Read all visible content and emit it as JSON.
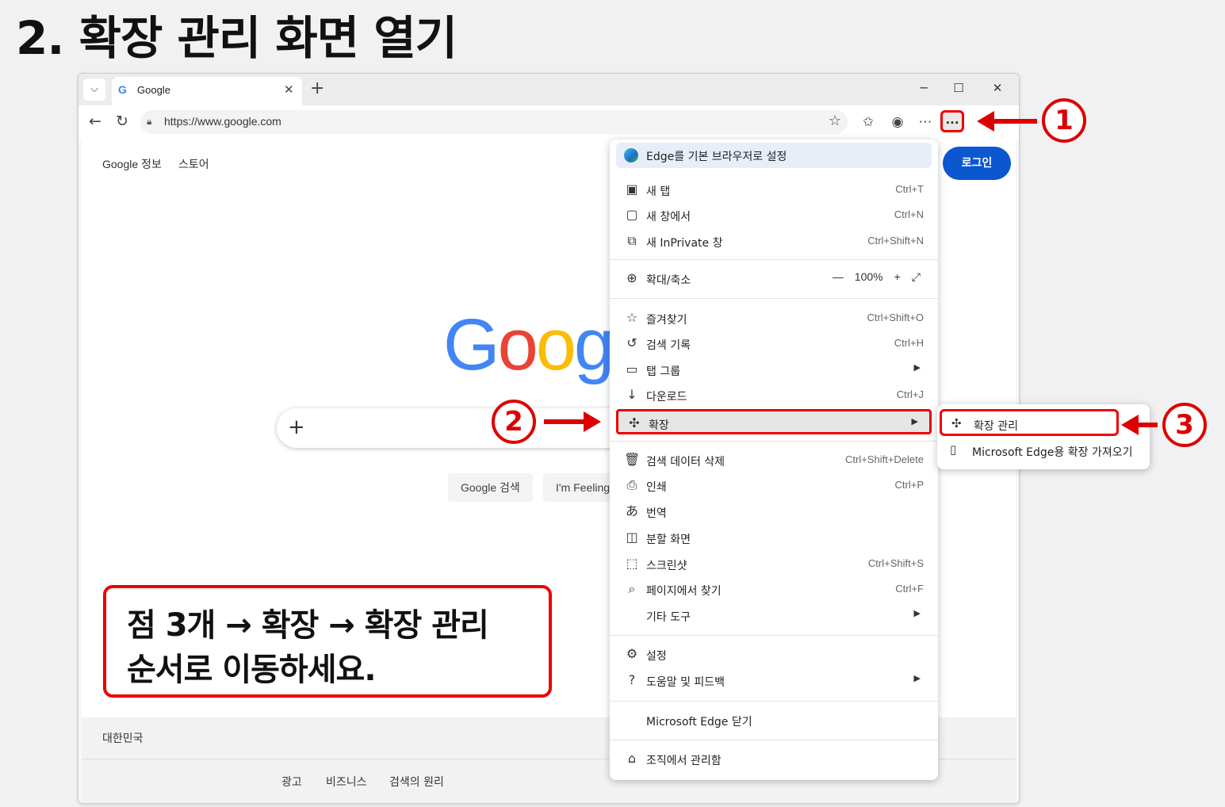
{
  "slide": {
    "title": "2. 확장 관리 화면 열기"
  },
  "browser": {
    "tab_title": "Google",
    "favicon": "G",
    "url": "https://www.google.com",
    "window_controls": [
      "─",
      "☐",
      "✕"
    ]
  },
  "google": {
    "top_links": [
      "Google 정보",
      "스토어"
    ],
    "login": "로그인",
    "logo_letters": [
      {
        "ch": "G",
        "color": "#4285F4"
      },
      {
        "ch": "o",
        "color": "#EA4335"
      },
      {
        "ch": "o",
        "color": "#FBBC05"
      },
      {
        "ch": "g",
        "color": "#4285F4"
      }
    ],
    "search_button": "Google 검색",
    "lucky_button": "I'm Feeling",
    "country": "대한민국",
    "footer_links": [
      "광고",
      "비즈니스",
      "검색의 원리"
    ]
  },
  "menu": {
    "banner": "Edge를 기본 브라우저로 설정",
    "items": [
      {
        "icon": "new-tab-icon",
        "glyph": "▣",
        "label": "새 탭",
        "shortcut": "Ctrl+T"
      },
      {
        "icon": "new-window-icon",
        "glyph": "▢",
        "label": "새 창에서",
        "shortcut": "Ctrl+N"
      },
      {
        "icon": "inprivate-icon",
        "glyph": "⧉",
        "label": "새 InPrivate 창",
        "shortcut": "Ctrl+Shift+N"
      },
      {
        "icon": "zoom-icon",
        "glyph": "⊕",
        "label": "확대/축소",
        "zoom": {
          "minus": "—",
          "value": "100%",
          "plus": "+",
          "full": "⤢"
        }
      },
      {
        "icon": "favorites-icon",
        "glyph": "☆",
        "label": "즐겨찾기",
        "shortcut": "Ctrl+Shift+O"
      },
      {
        "icon": "history-icon",
        "glyph": "↺",
        "label": "검색 기록",
        "shortcut": "Ctrl+H"
      },
      {
        "icon": "tab-groups-icon",
        "glyph": "▭",
        "label": "탭 그룹",
        "arrow": "▶"
      },
      {
        "icon": "download-icon",
        "glyph": "↓",
        "label": "다운로드",
        "shortcut": "Ctrl+J"
      },
      {
        "icon": "extensions-icon",
        "glyph": "✣",
        "label": "확장",
        "arrow": "▶"
      },
      {
        "icon": "delete-icon",
        "glyph": "🗑",
        "label": "검색 데이터 삭제",
        "shortcut": "Ctrl+Shift+Delete"
      },
      {
        "icon": "print-icon",
        "glyph": "⎙",
        "label": "인쇄",
        "shortcut": "Ctrl+P"
      },
      {
        "icon": "translate-icon",
        "glyph": "あ",
        "label": "번역"
      },
      {
        "icon": "split-screen-icon",
        "glyph": "◫",
        "label": "분할 화면"
      },
      {
        "icon": "screenshot-icon",
        "glyph": "⬚",
        "label": "스크린샷",
        "shortcut": "Ctrl+Shift+S"
      },
      {
        "icon": "find-icon",
        "glyph": "⌕",
        "label": "페이지에서 찾기",
        "shortcut": "Ctrl+F"
      },
      {
        "icon": "",
        "glyph": "",
        "label": "기타 도구",
        "arrow": "▶"
      },
      {
        "icon": "settings-icon",
        "glyph": "⚙",
        "label": "설정"
      },
      {
        "icon": "help-icon",
        "glyph": "?",
        "label": "도움말 및 피드백",
        "arrow": "▶"
      },
      {
        "icon": "",
        "glyph": "",
        "label": "Microsoft Edge 닫기"
      },
      {
        "icon": "organization-icon",
        "glyph": "⌂",
        "label": "조직에서 관리함"
      }
    ]
  },
  "submenu": {
    "items": [
      {
        "icon": "extensions-icon",
        "glyph": "✣",
        "label": "확장 관리"
      },
      {
        "icon": "store-icon",
        "glyph": "▯",
        "label": "Microsoft Edge용 확장 가져오기"
      }
    ]
  },
  "callout": {
    "line1": "점 3개 → 확장 → 확장 관리",
    "line2": "순서로 이동하세요."
  },
  "annotations": {
    "step1": "1",
    "step2": "2",
    "step3": "3",
    "color": "#DD0000"
  }
}
